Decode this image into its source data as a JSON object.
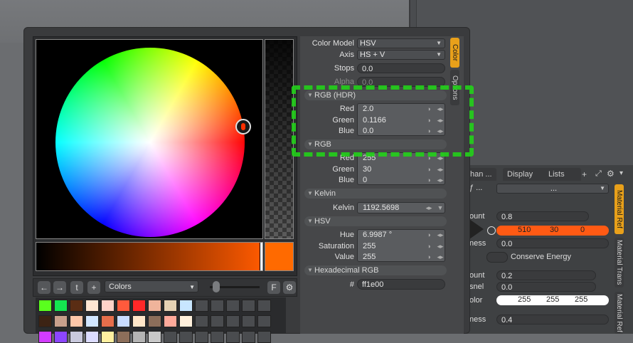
{
  "background": {
    "tabs": [
      "han ...",
      "Display",
      "Lists"
    ],
    "lower_rows": [
      {
        "label": "ount",
        "value": "0.8"
      },
      {
        "label": "",
        "values": [
          "510",
          "30",
          "0"
        ]
      },
      {
        "label": "ness",
        "value": "0.0"
      },
      {
        "label": "",
        "checkbox_label": "Conserve Energy"
      },
      {
        "label": "ount",
        "value": "0.2"
      },
      {
        "label": "snel",
        "value": "0.0"
      },
      {
        "label": "olor",
        "values": [
          "255",
          "255",
          "255"
        ]
      },
      {
        "label": "ness",
        "value": "0.4"
      }
    ],
    "top_dropdown": "...",
    "top_dropdown_prefix": "ƒ ...",
    "vtabs": [
      "Material Ref",
      "Material Trans",
      "Material Ref"
    ]
  },
  "dialog": {
    "side_tabs": [
      "Color",
      "Options"
    ],
    "color_model": {
      "label": "Color Model",
      "value": "HSV"
    },
    "axis": {
      "label": "Axis",
      "value": "HS + V"
    },
    "stops": {
      "label": "Stops",
      "value": "0.0"
    },
    "alpha": {
      "label": "Alpha",
      "value": "0.0"
    },
    "rgb_hdr": {
      "title": "RGB (HDR)",
      "red_label": "Red",
      "red": "2.0",
      "green_label": "Green",
      "green": "0.1166",
      "blue_label": "Blue",
      "blue": "0.0"
    },
    "rgb": {
      "title": "RGB",
      "red_label": "Red",
      "red": "255",
      "green_label": "Green",
      "green": "30",
      "blue_label": "Blue",
      "blue": "0"
    },
    "kelvin": {
      "title": "Kelvin",
      "label": "Kelvin",
      "value": "1192.5698"
    },
    "hsv": {
      "title": "HSV",
      "hue_label": "Hue",
      "hue": "6.9987 °",
      "sat_label": "Saturation",
      "sat": "255",
      "val_label": "Value",
      "val": "255"
    },
    "hex": {
      "title": "Hexadecimal RGB",
      "label": "#",
      "value": "ff1e00"
    },
    "preset_dropdown": "Colors",
    "f_button": "F",
    "swatch_colors": [
      "#5aff1e",
      "#14e650",
      "#5a2d14",
      "#ffe6d2",
      "#ffd2c8",
      "#ff5a3c",
      "#ff2828",
      "#f0b49b",
      "#e6d2b4",
      "#c8e6ff",
      "#3c2314",
      "#c8a08c",
      "#ffc8aa",
      "#d2e6ff",
      "#e66e4b",
      "#c8dcff",
      "#ffe6c8",
      "#8c6e5a",
      "#ffaa9b",
      "#fff0dc"
    ]
  },
  "colors": {
    "accent": "#e8a01a",
    "current": "#ff6a00",
    "highlight": "#ff5a14"
  }
}
